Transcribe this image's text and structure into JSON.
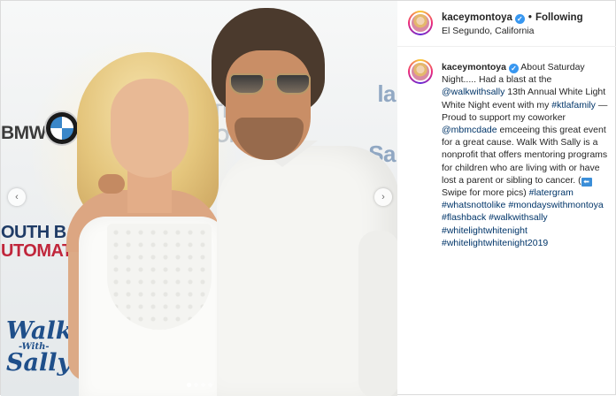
{
  "post": {
    "username": "kaceymontoya",
    "verified_mark": "✓",
    "follow_separator": "•",
    "follow_status": "Following",
    "location": "El Segundo, California",
    "caption": {
      "username": "kaceymontoya",
      "t1": " About Saturday Night..... Had a blast at the ",
      "mention1": "@walkwithsally",
      "t2": " 13th Annual White Light White Night event with my ",
      "hashtag1": "#ktlafamily",
      "t3": " — Proud to support my coworker ",
      "mention2": "@mbmcdade",
      "t4": " emceeing this great event for a great cause. Walk With Sally is a nonprofit that offers mentoring programs for children who are living with or have lost a parent or sibling to cancer. (",
      "emoji": "⬅",
      "t5": "Swipe for more pics) ",
      "tags": [
        "#latergram",
        "#whatsnottolike",
        "#mondayswithmontoya",
        "#flashback",
        "#walkwithsally",
        "#whitelightwhitenight",
        "#whitelightwhitenight2019"
      ]
    }
  },
  "photo": {
    "signage": {
      "bmw": "BMW",
      "auto_top": "UTH",
      "auto_mid": "AUTOMAT",
      "south_line1": "OUTH B",
      "south_line2": "UTOMAT",
      "walk": "Walk",
      "with": "-With-",
      "sally": "Sally",
      "right1": "la",
      "right2": "Sa"
    },
    "carousel": {
      "prev_icon": "‹",
      "next_icon": "›",
      "slide_count": 4,
      "active_index": 0
    }
  },
  "colors": {
    "link": "#003569",
    "verified": "#3897f0",
    "border": "#dbdbdb"
  }
}
